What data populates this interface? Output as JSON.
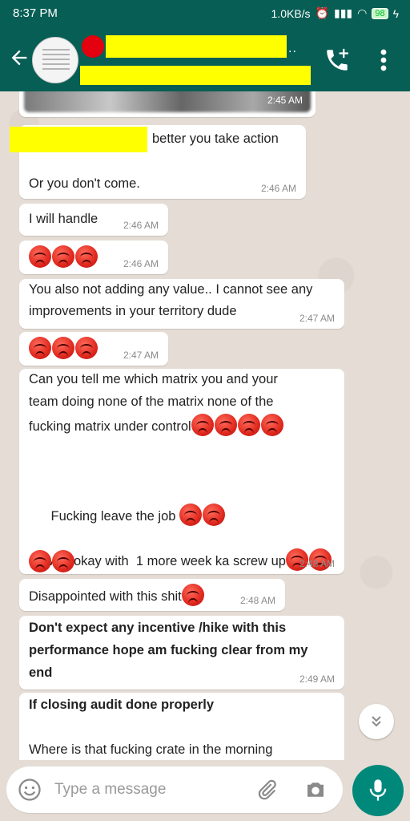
{
  "status": {
    "time": "8:37 PM",
    "speed": "1.0KB/s",
    "battery": "98"
  },
  "header": {
    "title_suffix": ".."
  },
  "messages": [
    {
      "id": "m0",
      "time": "2:45 AM"
    },
    {
      "id": "m1",
      "text": "better you take action",
      "text2": "Or you don't come.",
      "time": "2:46 AM"
    },
    {
      "id": "m2",
      "text": "I will handle",
      "time": "2:46 AM"
    },
    {
      "id": "m3",
      "emoji_count": 3,
      "time": "2:46 AM"
    },
    {
      "id": "m4",
      "line1": "You also not adding any value.. I cannot see any",
      "line2": "improvements in your territory dude",
      "time": "2:47 AM"
    },
    {
      "id": "m5",
      "emoji_count": 3,
      "time": "2:47 AM"
    },
    {
      "id": "m6",
      "line1": "Can you tell me which matrix you and your",
      "line2": "team doing none of the matrix none of the",
      "line3": "fucking matrix under control",
      "line4": "Fucking leave the job ",
      "line5": "Am okay with  1 more week ka screw up",
      "time": "2:48 AM"
    },
    {
      "id": "m7",
      "text": "Disappointed with this shit",
      "time": "2:48 AM"
    },
    {
      "id": "m8",
      "line1": "Don't expect any incentive /hike with this",
      "line2": "performance hope am fucking clear from my",
      "line3": "end",
      "time": "2:49 AM"
    },
    {
      "id": "m9",
      "line1": "If closing audit done properly",
      "line2": "Where is that fucking crate in the morning"
    }
  ],
  "input": {
    "placeholder": "Type a message"
  },
  "colors": {
    "header": "#075e54",
    "chat_bg": "#e5ddd5",
    "mic": "#00897b",
    "redact": "#ffff00"
  }
}
